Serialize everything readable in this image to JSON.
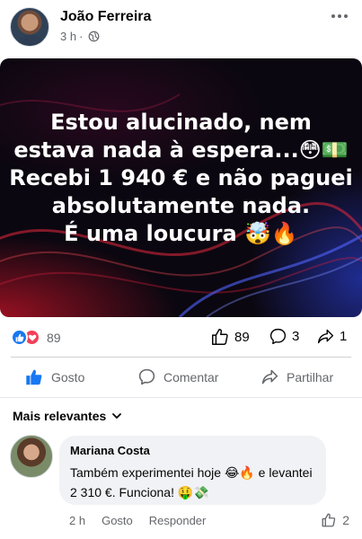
{
  "post": {
    "author": "João Ferreira",
    "time": "3 h",
    "separator": "·",
    "image_text": [
      "Estou alucinado, nem",
      "estava nada à espera...😳💵",
      "Recebi 1 940 € e não paguei",
      "absolutamente nada.",
      "É uma loucura 🤯🔥"
    ]
  },
  "stats": {
    "reactions": "89",
    "likes": "89",
    "comments": "3",
    "shares": "1"
  },
  "actions": {
    "like": "Gosto",
    "comment": "Comentar",
    "share": "Partilhar"
  },
  "comments_section": {
    "sort_label": "Mais relevantes",
    "comment": {
      "author": "Mariana Costa",
      "text": "Também experimentei hoje 😂🔥 e levantei 2 310 €. Funciona! 🤑💸",
      "time": "2 h",
      "like": "Gosto",
      "reply": "Responder",
      "likes": "2"
    }
  },
  "colors": {
    "facebook_blue": "#1877f2",
    "love_red": "#f33e58",
    "secondary_text": "#65676b",
    "bubble_bg": "#f0f2f5"
  },
  "icons": [
    "globe-icon",
    "more-icon",
    "like-icon",
    "love-icon",
    "comment-icon",
    "share-icon",
    "chevron-down-icon"
  ]
}
